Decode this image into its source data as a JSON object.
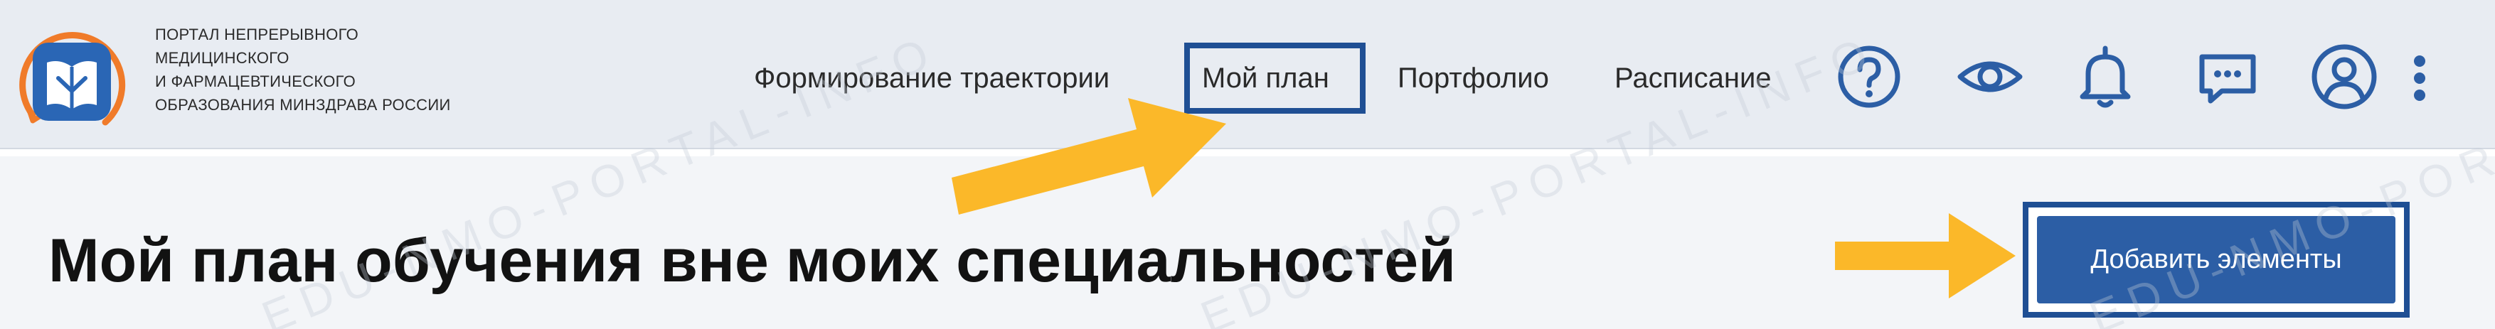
{
  "logo": {
    "lines": [
      "ПОРТАЛ НЕПРЕРЫВНОГО",
      "МЕДИЦИНСКОГО",
      "И ФАРМАЦЕВТИЧЕСКОГО",
      "ОБРАЗОВАНИЯ МИНЗДРАВА РОССИИ"
    ]
  },
  "nav": {
    "items": [
      {
        "label": "Формирование траектории"
      },
      {
        "label": "Мой план"
      },
      {
        "label": "Портфолио"
      },
      {
        "label": "Расписание"
      }
    ]
  },
  "header_icons": [
    "help-icon",
    "eye-icon",
    "bell-icon",
    "chat-icon",
    "user-icon",
    "more-vertical-icon"
  ],
  "main": {
    "title": "Мой план обучения вне моих специальностей",
    "add_button_label": "Добавить элементы"
  },
  "watermark": {
    "text": "EDU-NMO-PORTAL-INFO"
  },
  "colors": {
    "header_bg": "#e8ecf2",
    "content_bg": "#f3f5f8",
    "brand_blue": "#2c5ea5",
    "highlight_border": "#1f4f94",
    "arrow": "#fbb829",
    "logo_orange": "#f07b2a"
  }
}
